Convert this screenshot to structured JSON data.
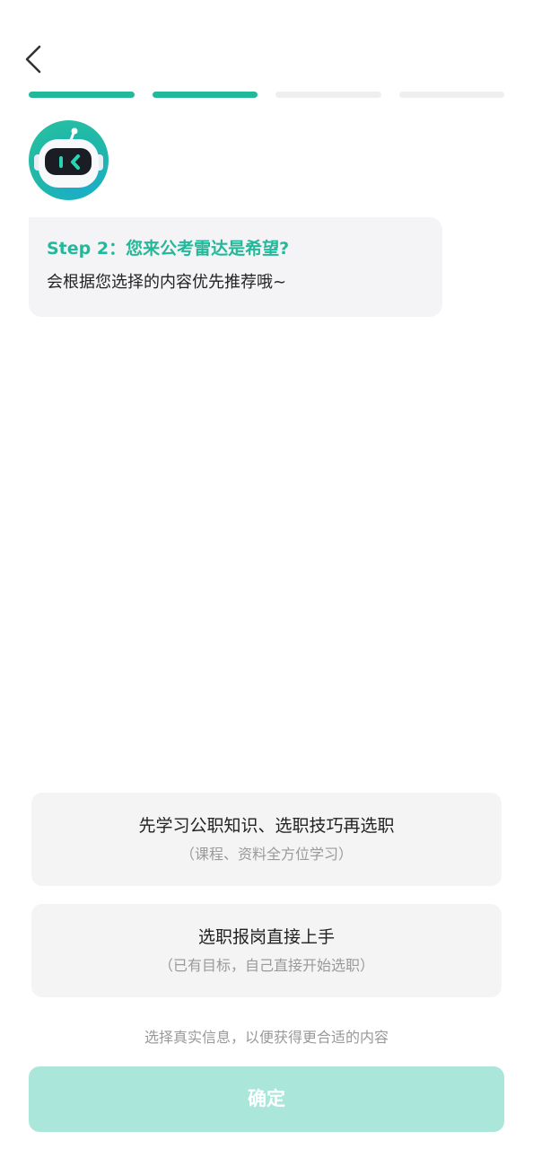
{
  "icons": {
    "back": "chevron-left-icon",
    "avatar": "robot-avatar-icon"
  },
  "progress": {
    "total_steps": 4,
    "current_step": 2
  },
  "message": {
    "title": "Step 2：您来公考雷达是希望?",
    "text": "会根据您选择的内容优先推荐哦~"
  },
  "options": [
    {
      "label": "先学习公职知识、选职技巧再选职",
      "sub": "（课程、资料全方位学习）"
    },
    {
      "label": "选职报岗直接上手",
      "sub": "（已有目标，自己直接开始选职）"
    }
  ],
  "hint": "选择真实信息，以便获得更合适的内容",
  "confirm_label": "确定",
  "colors": {
    "accent": "#22b99a",
    "accent_disabled": "#abe6db",
    "card_bg": "#f4f4f5"
  }
}
